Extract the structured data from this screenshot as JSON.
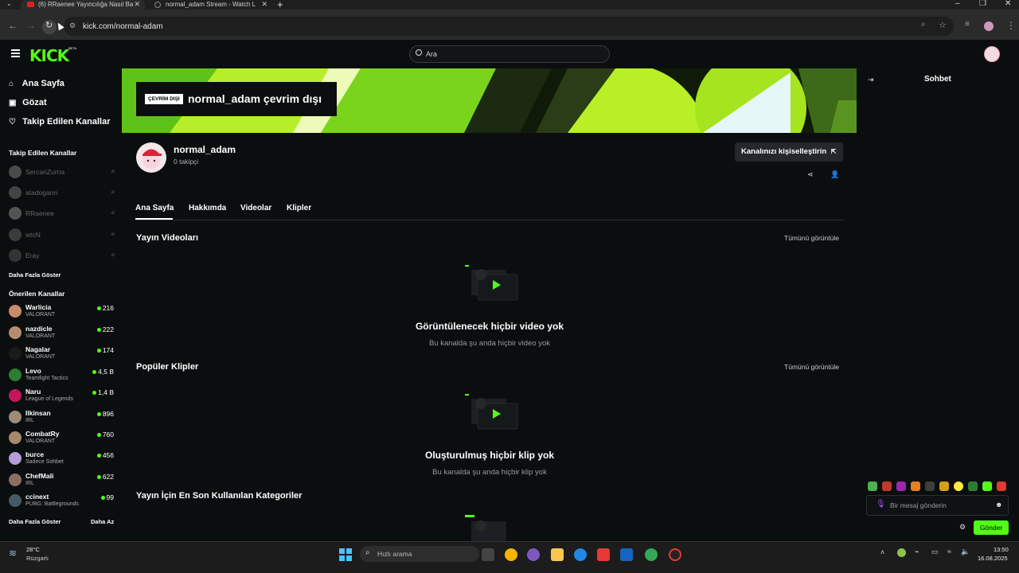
{
  "browser": {
    "tabs": [
      {
        "title": "(6) RRaenee Yayıncılığa Nasıl Ba"
      },
      {
        "title": "normal_adam Stream - Watch L"
      }
    ],
    "url": "kick.com/normal-adam"
  },
  "header": {
    "logo": "KICK",
    "logo_badge": "BETA",
    "search_placeholder": "Ara"
  },
  "sidebar": {
    "nav": [
      {
        "label": "Ana Sayfa",
        "icon": "home-icon"
      },
      {
        "label": "Gözat",
        "icon": "browse-icon"
      },
      {
        "label": "Takip Edilen Kanallar",
        "icon": "heart-icon"
      }
    ],
    "followed_heading": "Takip Edilen Kanallar",
    "followed": [
      {
        "name": "SercanZurna"
      },
      {
        "name": "atadogann"
      },
      {
        "name": "RRaenee"
      },
      {
        "name": "wtcN"
      },
      {
        "name": "Eray"
      }
    ],
    "show_more": "Daha Fazla Göster",
    "recommended_heading": "Önerilen Kanallar",
    "recommended": [
      {
        "name": "Warlicia",
        "category": "VALORANT",
        "viewers": "216",
        "color": "#c98b6a"
      },
      {
        "name": "nazdicle",
        "category": "VALORANT",
        "viewers": "222",
        "color": "#b58e71"
      },
      {
        "name": "Nagalar",
        "category": "VALORANT",
        "viewers": "174",
        "color": "#1a1a1a"
      },
      {
        "name": "Levo",
        "category": "Teamfight Tactics",
        "viewers": "4,5 B",
        "color": "#2e7d32"
      },
      {
        "name": "Naru",
        "category": "League of Legends",
        "viewers": "1,4 B",
        "color": "#c2185b"
      },
      {
        "name": "Ilkinsan",
        "category": "IRL",
        "viewers": "896",
        "color": "#9e8c7a"
      },
      {
        "name": "CombatRy",
        "category": "VALORANT",
        "viewers": "760",
        "color": "#a68a6a"
      },
      {
        "name": "burce",
        "category": "Sadece Sohbet",
        "viewers": "456",
        "color": "#b39ddb"
      },
      {
        "name": "ChefMali",
        "category": "IRL",
        "viewers": "622",
        "color": "#8d6e63"
      },
      {
        "name": "ccinext",
        "category": "PUBG: Battlegrounds",
        "viewers": "99",
        "color": "#455a64"
      }
    ],
    "show_more_bottom": "Daha Fazla Göster",
    "show_less": "Daha Az"
  },
  "channel": {
    "offline_badge": "ÇEVRİM DIŞI",
    "offline_title": "normal_adam çevrim dışı",
    "name": "normal_adam",
    "followers": "0 takipçi",
    "customize_button": "Kanalınızı kişiselleştirin",
    "tabs": [
      "Ana Sayfa",
      "Hakkımda",
      "Videolar",
      "Klipler"
    ],
    "sections": {
      "videos": {
        "heading": "Yayın Videoları",
        "see_all": "Tümünü görüntüle",
        "empty_title": "Görüntülenecek hiçbir video yok",
        "empty_sub": "Bu kanalda şu anda hiçbir video yok"
      },
      "clips": {
        "heading": "Popüler Klipler",
        "see_all": "Tümünü görüntüle",
        "empty_title": "Oluşturulmuş hiçbir klip yok",
        "empty_sub": "Bu kanalda şu anda hiçbir klip yok"
      },
      "categories": {
        "heading": "Yayın İçin En Son Kullanılan Kategoriler"
      }
    }
  },
  "chat": {
    "title": "Sohbet",
    "input_placeholder": "Bir mesaj gönderin",
    "send_button": "Gönder"
  },
  "taskbar": {
    "temperature": "28°C",
    "weather": "Rüzgarlı",
    "search_placeholder": "Hızlı arama",
    "time": "13:50",
    "date": "16.08.2025"
  },
  "colors": {
    "accent": "#53fc18",
    "background": "#0b0e0f"
  }
}
